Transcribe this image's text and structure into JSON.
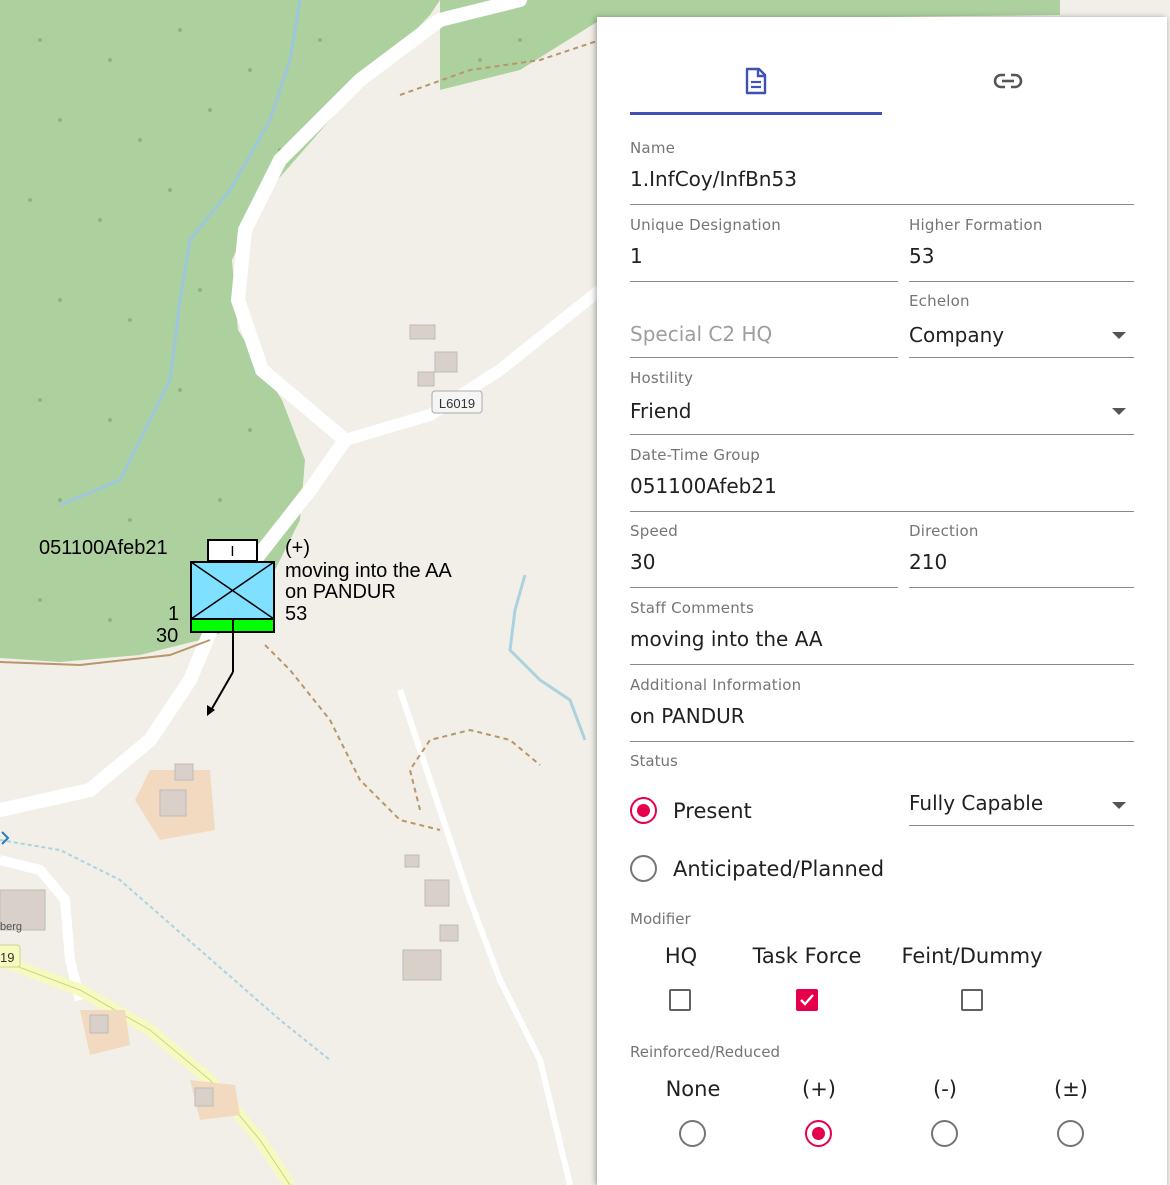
{
  "map": {
    "road_ref": "L6019",
    "road_ref_partial": "19",
    "place_partial": "berg",
    "unit": {
      "dtg_label": "051100Afeb21",
      "reinforced_label": "(+)",
      "staff_comments_label": "moving into the AA",
      "additional_info_label": "on PANDUR",
      "higher_formation_label": "53",
      "unique_designation_label": "1",
      "speed_label": "30",
      "echelon_mark": "I",
      "frame_color": "#80e0ff",
      "mobility_color": "#00ff00"
    }
  },
  "panel": {
    "tabs": [
      {
        "icon": "document-icon",
        "selected": true
      },
      {
        "icon": "link-icon",
        "selected": false
      }
    ],
    "accent_color": "#3f51b5",
    "check_color": "#e6004c",
    "name": {
      "label": "Name",
      "value": "1.InfCoy/InfBn53"
    },
    "unique_designation": {
      "label": "Unique Designation",
      "value": "1"
    },
    "higher_formation": {
      "label": "Higher Formation",
      "value": "53"
    },
    "special_c2": {
      "placeholder": "Special C2 HQ"
    },
    "echelon": {
      "label": "Echelon",
      "value": "Company"
    },
    "hostility": {
      "label": "Hostility",
      "value": "Friend"
    },
    "dtg": {
      "label": "Date-Time Group",
      "value": "051100Afeb21"
    },
    "speed": {
      "label": "Speed",
      "value": "30"
    },
    "direction": {
      "label": "Direction",
      "value": "210"
    },
    "staff_comments": {
      "label": "Staff Comments",
      "value": "moving into the AA"
    },
    "additional_info": {
      "label": "Additional Information",
      "value": "on PANDUR"
    },
    "status": {
      "label": "Status",
      "present": {
        "label": "Present",
        "selected": true
      },
      "anticipated": {
        "label": "Anticipated/Planned",
        "selected": false
      },
      "capability": "Fully Capable"
    },
    "modifier": {
      "label": "Modifier",
      "items": [
        {
          "label": "HQ",
          "checked": false
        },
        {
          "label": "Task Force",
          "checked": true
        },
        {
          "label": "Feint/Dummy",
          "checked": false
        }
      ]
    },
    "reinforced": {
      "label": "Reinforced/Reduced",
      "options": [
        {
          "label": "None",
          "selected": false
        },
        {
          "label": "(+)",
          "selected": true
        },
        {
          "label": "(-)",
          "selected": false
        },
        {
          "label": "(±)",
          "selected": false
        }
      ]
    }
  }
}
